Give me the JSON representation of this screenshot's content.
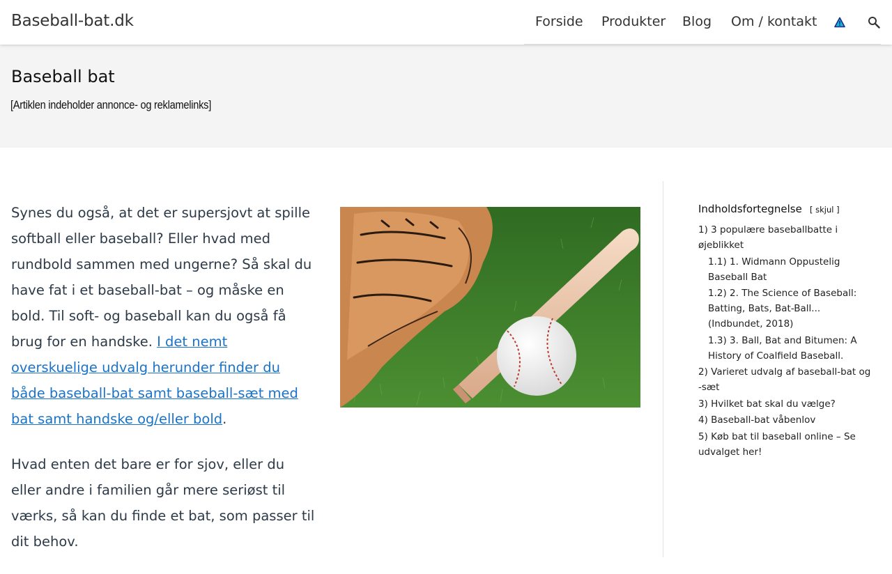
{
  "header": {
    "site_title": "Baseball-bat.dk",
    "nav": [
      "Forside",
      "Produkter",
      "Blog",
      "Om / kontakt"
    ],
    "icons": [
      "warning-triangle-icon",
      "search-icon"
    ]
  },
  "hero": {
    "title": "Baseball bat",
    "note": "[Artiklen indeholder annonce- og reklamelinks]"
  },
  "main": {
    "p1_text": "Synes du også, at det er supersjovt at spille softball eller baseball? Eller hvad med rundbold sammen med ungerne? Så skal du have fat i et baseball-bat – og måske en bold. Til soft- og baseball kan du også få brug for en handske. ",
    "p1_link": "I det nemt overskuelige udvalg herunder finder du både baseball-bat samt baseball-sæt med bat samt handske og/eller bold",
    "p1_end": ".",
    "p2_text": "Hvad enten det bare er for sjov, eller du eller andre i familien går mere seriøst til værks, så kan du finde et bat, som passer til dit behov."
  },
  "toc": {
    "title": "Indholdsfortegnelse",
    "toggle_open": "[",
    "toggle_label": "skjul",
    "toggle_close": "]",
    "items": [
      "1) 3 populære baseballbatte i øjeblikket",
      "1.1) 1. Widmann Oppustelig Baseball Bat",
      "1.2) 2. The Science of Baseball: Batting, Bats, Bat-Ball... (Indbundet, 2018)",
      "1.3) 3. Ball, Bat and Bitumen: A History of Coalfield Baseball.",
      "2) Varieret udvalg af baseball-bat og -sæt",
      "3) Hvilket bat skal du vælge?",
      "4) Baseball-bat våbenlov",
      "5) Køb bat til baseball online – Se udvalget her!"
    ]
  }
}
